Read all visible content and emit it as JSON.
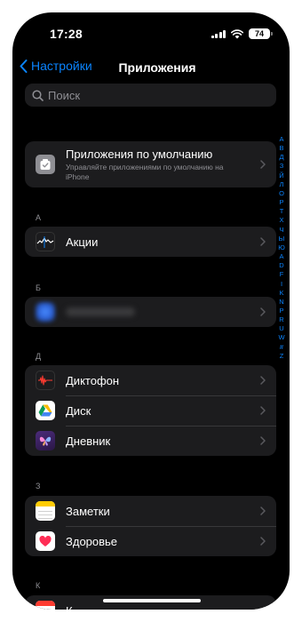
{
  "status_bar": {
    "time": "17:28",
    "battery": "74"
  },
  "nav": {
    "back_label": "Настройки",
    "title": "Приложения"
  },
  "search": {
    "placeholder": "Поиск"
  },
  "default_apps": {
    "title": "Приложения по умолчанию",
    "subtitle": "Управляйте приложениями по умолчанию на iPhone"
  },
  "sections": [
    {
      "letter": "А",
      "items": [
        {
          "label": "Акции",
          "icon": "stocks-icon"
        }
      ]
    },
    {
      "letter": "Б",
      "items": [
        {
          "label": "",
          "icon": "blurred-app-icon"
        }
      ]
    },
    {
      "letter": "Д",
      "items": [
        {
          "label": "Диктофон",
          "icon": "voice-memos-icon"
        },
        {
          "label": "Диск",
          "icon": "google-drive-icon"
        },
        {
          "label": "Дневник",
          "icon": "journal-icon"
        }
      ]
    },
    {
      "letter": "З",
      "items": [
        {
          "label": "Заметки",
          "icon": "notes-icon"
        },
        {
          "label": "Здоровье",
          "icon": "health-icon"
        }
      ]
    },
    {
      "letter": "К",
      "items": [
        {
          "label": "К",
          "icon": "calendar-icon"
        }
      ]
    }
  ],
  "index_letters": [
    "А",
    "В",
    "Д",
    "З",
    "Й",
    "Л",
    "О",
    "Р",
    "Т",
    "Х",
    "Ч",
    "Ы",
    "Ю",
    "А",
    "D",
    "F",
    "I",
    "K",
    "N",
    "P",
    "R",
    "U",
    "W",
    "#",
    "Z"
  ],
  "colors": {
    "accent": "#0a84ff",
    "background": "#000000",
    "cell": "#1c1c1e",
    "secondary_text": "#8e8e93"
  }
}
